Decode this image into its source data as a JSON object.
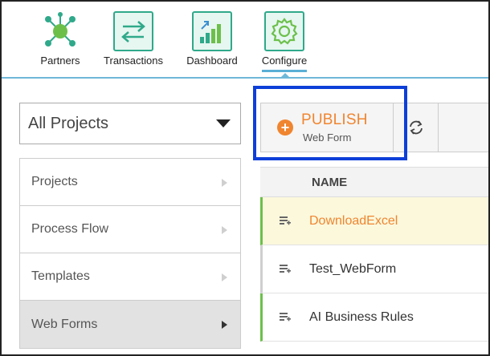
{
  "nav": {
    "items": [
      {
        "label": "Partners",
        "icon": "partners-network-icon"
      },
      {
        "label": "Transactions",
        "icon": "transactions-arrows-icon"
      },
      {
        "label": "Dashboard",
        "icon": "dashboard-chart-icon"
      },
      {
        "label": "Configure",
        "icon": "gear-icon"
      }
    ],
    "active": "Configure"
  },
  "project_select": {
    "value": "All Projects"
  },
  "sidemenu": {
    "items": [
      {
        "label": "Projects"
      },
      {
        "label": "Process Flow"
      },
      {
        "label": "Templates"
      },
      {
        "label": "Web Forms"
      }
    ],
    "active": "Web Forms"
  },
  "toolbar": {
    "publish_label": "PUBLISH",
    "publish_sub": "Web Form"
  },
  "table": {
    "header": "NAME",
    "rows": [
      {
        "name": "DownloadExcel",
        "selected": true
      },
      {
        "name": "Test_WebForm",
        "selected": false
      },
      {
        "name": "AI Business Rules",
        "selected": false
      }
    ]
  },
  "colors": {
    "accent": "#f0852f",
    "teal": "#2fa98a",
    "highlight": "#0d3fd8",
    "nav_line": "#6fb8d8",
    "status_green": "#6cc04a"
  }
}
